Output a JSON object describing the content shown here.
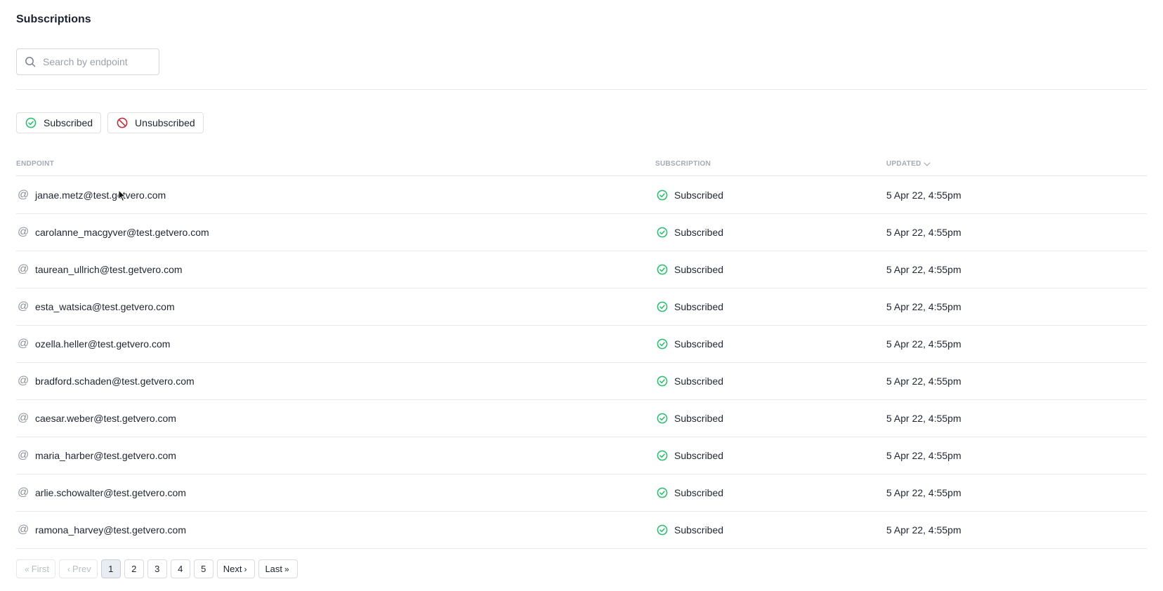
{
  "page": {
    "title": "Subscriptions"
  },
  "search": {
    "placeholder": "Search by endpoint",
    "value": ""
  },
  "filters": [
    {
      "label": "Subscribed",
      "icon": "check-circle-icon",
      "color": "#2fbf71"
    },
    {
      "label": "Unsubscribed",
      "icon": "ban-icon",
      "color": "#c0303a"
    }
  ],
  "table": {
    "columns": {
      "endpoint": "ENDPOINT",
      "subscription": "SUBSCRIPTION",
      "updated": "UPDATED"
    },
    "sort": {
      "column": "updated",
      "direction": "desc"
    },
    "rows": [
      {
        "endpoint": "janae.metz@test.getvero.com",
        "subscription": "Subscribed",
        "updated": "5 Apr 22, 4:55pm"
      },
      {
        "endpoint": "carolanne_macgyver@test.getvero.com",
        "subscription": "Subscribed",
        "updated": "5 Apr 22, 4:55pm"
      },
      {
        "endpoint": "taurean_ullrich@test.getvero.com",
        "subscription": "Subscribed",
        "updated": "5 Apr 22, 4:55pm"
      },
      {
        "endpoint": "esta_watsica@test.getvero.com",
        "subscription": "Subscribed",
        "updated": "5 Apr 22, 4:55pm"
      },
      {
        "endpoint": "ozella.heller@test.getvero.com",
        "subscription": "Subscribed",
        "updated": "5 Apr 22, 4:55pm"
      },
      {
        "endpoint": "bradford.schaden@test.getvero.com",
        "subscription": "Subscribed",
        "updated": "5 Apr 22, 4:55pm"
      },
      {
        "endpoint": "caesar.weber@test.getvero.com",
        "subscription": "Subscribed",
        "updated": "5 Apr 22, 4:55pm"
      },
      {
        "endpoint": "maria_harber@test.getvero.com",
        "subscription": "Subscribed",
        "updated": "5 Apr 22, 4:55pm"
      },
      {
        "endpoint": "arlie.schowalter@test.getvero.com",
        "subscription": "Subscribed",
        "updated": "5 Apr 22, 4:55pm"
      },
      {
        "endpoint": "ramona_harvey@test.getvero.com",
        "subscription": "Subscribed",
        "updated": "5 Apr 22, 4:55pm"
      }
    ]
  },
  "pagination": {
    "first": "First",
    "prev": "Prev",
    "pages": [
      "1",
      "2",
      "3",
      "4",
      "5"
    ],
    "current": "1",
    "next": "Next",
    "last": "Last"
  }
}
